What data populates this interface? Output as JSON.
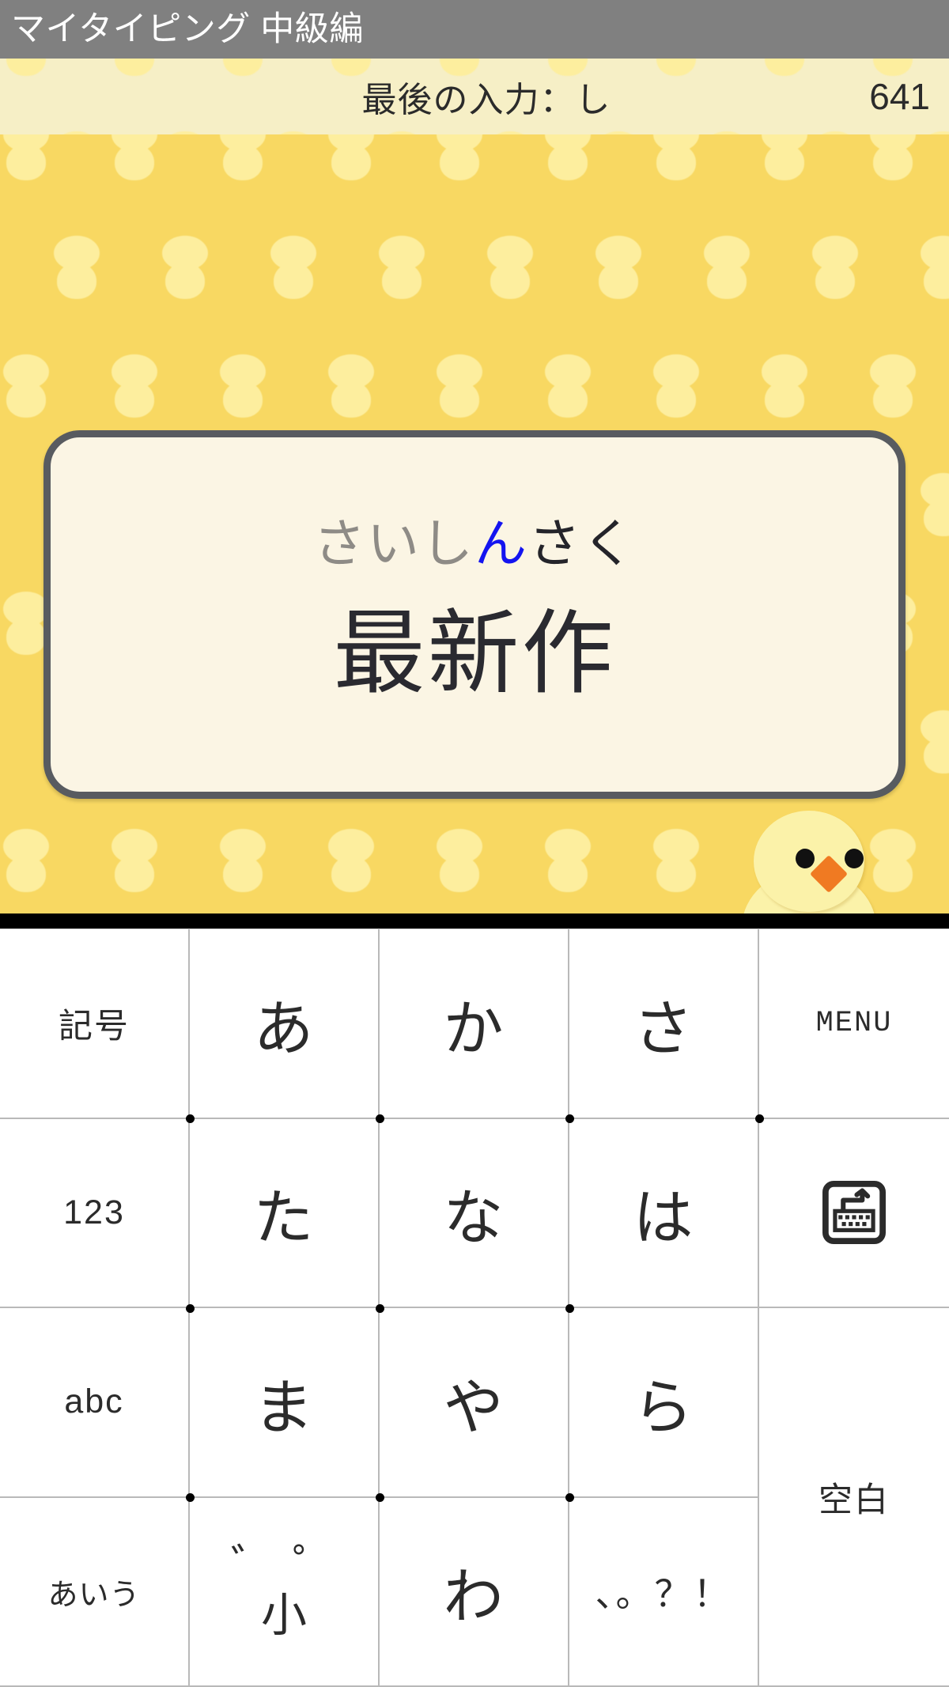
{
  "titlebar": {
    "title": "マイタイピング 中級編"
  },
  "statusbar": {
    "last_input_label": "最後の入力：し",
    "score": "641"
  },
  "word_card": {
    "kana_done": "さいし",
    "kana_current": "ん",
    "kana_todo": "さく",
    "kanji": "最新作"
  },
  "colors": {
    "titlebar_bg": "#808080",
    "statusbar_bg": "#F6EFC6",
    "game_bg": "#F8D862",
    "wallpaper_chick": "#FDEE9E",
    "card_bg": "#FBF5E4",
    "card_border": "#585b60",
    "kana_done": "#8e8b86",
    "kana_current": "#1414f0",
    "kana_todo": "#24242a",
    "kanji": "#2a2a30",
    "mascot_body": "#FBF2A9",
    "mascot_beak": "#F07A22",
    "key_bg": "#ffffff",
    "key_border": "#b9b9b9",
    "separator": "#000000"
  },
  "keyboard": {
    "keys": [
      {
        "id": "kigou",
        "label": "記号",
        "style": "small",
        "icon": null
      },
      {
        "id": "a",
        "label": "あ",
        "style": "kana-key",
        "icon": null
      },
      {
        "id": "ka",
        "label": "か",
        "style": "kana-key",
        "icon": null
      },
      {
        "id": "sa",
        "label": "さ",
        "style": "kana-key",
        "icon": null
      },
      {
        "id": "menu",
        "label": "MENU",
        "style": "menu",
        "icon": null
      },
      {
        "id": "123",
        "label": "123",
        "style": "small",
        "icon": null
      },
      {
        "id": "ta",
        "label": "た",
        "style": "kana-key",
        "icon": null
      },
      {
        "id": "na",
        "label": "な",
        "style": "kana-key",
        "icon": null
      },
      {
        "id": "ha",
        "label": "は",
        "style": "kana-key",
        "icon": null
      },
      {
        "id": "hide-kb",
        "label": "",
        "style": "icon",
        "icon": "keyboard-hide-icon"
      },
      {
        "id": "abc",
        "label": "abc",
        "style": "small",
        "icon": null
      },
      {
        "id": "ma",
        "label": "ま",
        "style": "kana-key",
        "icon": null
      },
      {
        "id": "ya",
        "label": "や",
        "style": "kana-key",
        "icon": null
      },
      {
        "id": "ra",
        "label": "ら",
        "style": "kana-key",
        "icon": null
      },
      {
        "id": "space",
        "label": "空白",
        "style": "small span2",
        "icon": null
      },
      {
        "id": "aiu",
        "label": "あいう",
        "style": "tiny",
        "icon": null
      },
      {
        "id": "dakuten",
        "label": "",
        "style": "dakuten",
        "icon": null,
        "top": "゛゜",
        "bottom": "小"
      },
      {
        "id": "wa",
        "label": "わ",
        "style": "kana-key",
        "icon": null
      },
      {
        "id": "punct",
        "label": "、。？！",
        "style": "punct",
        "icon": null
      }
    ]
  }
}
